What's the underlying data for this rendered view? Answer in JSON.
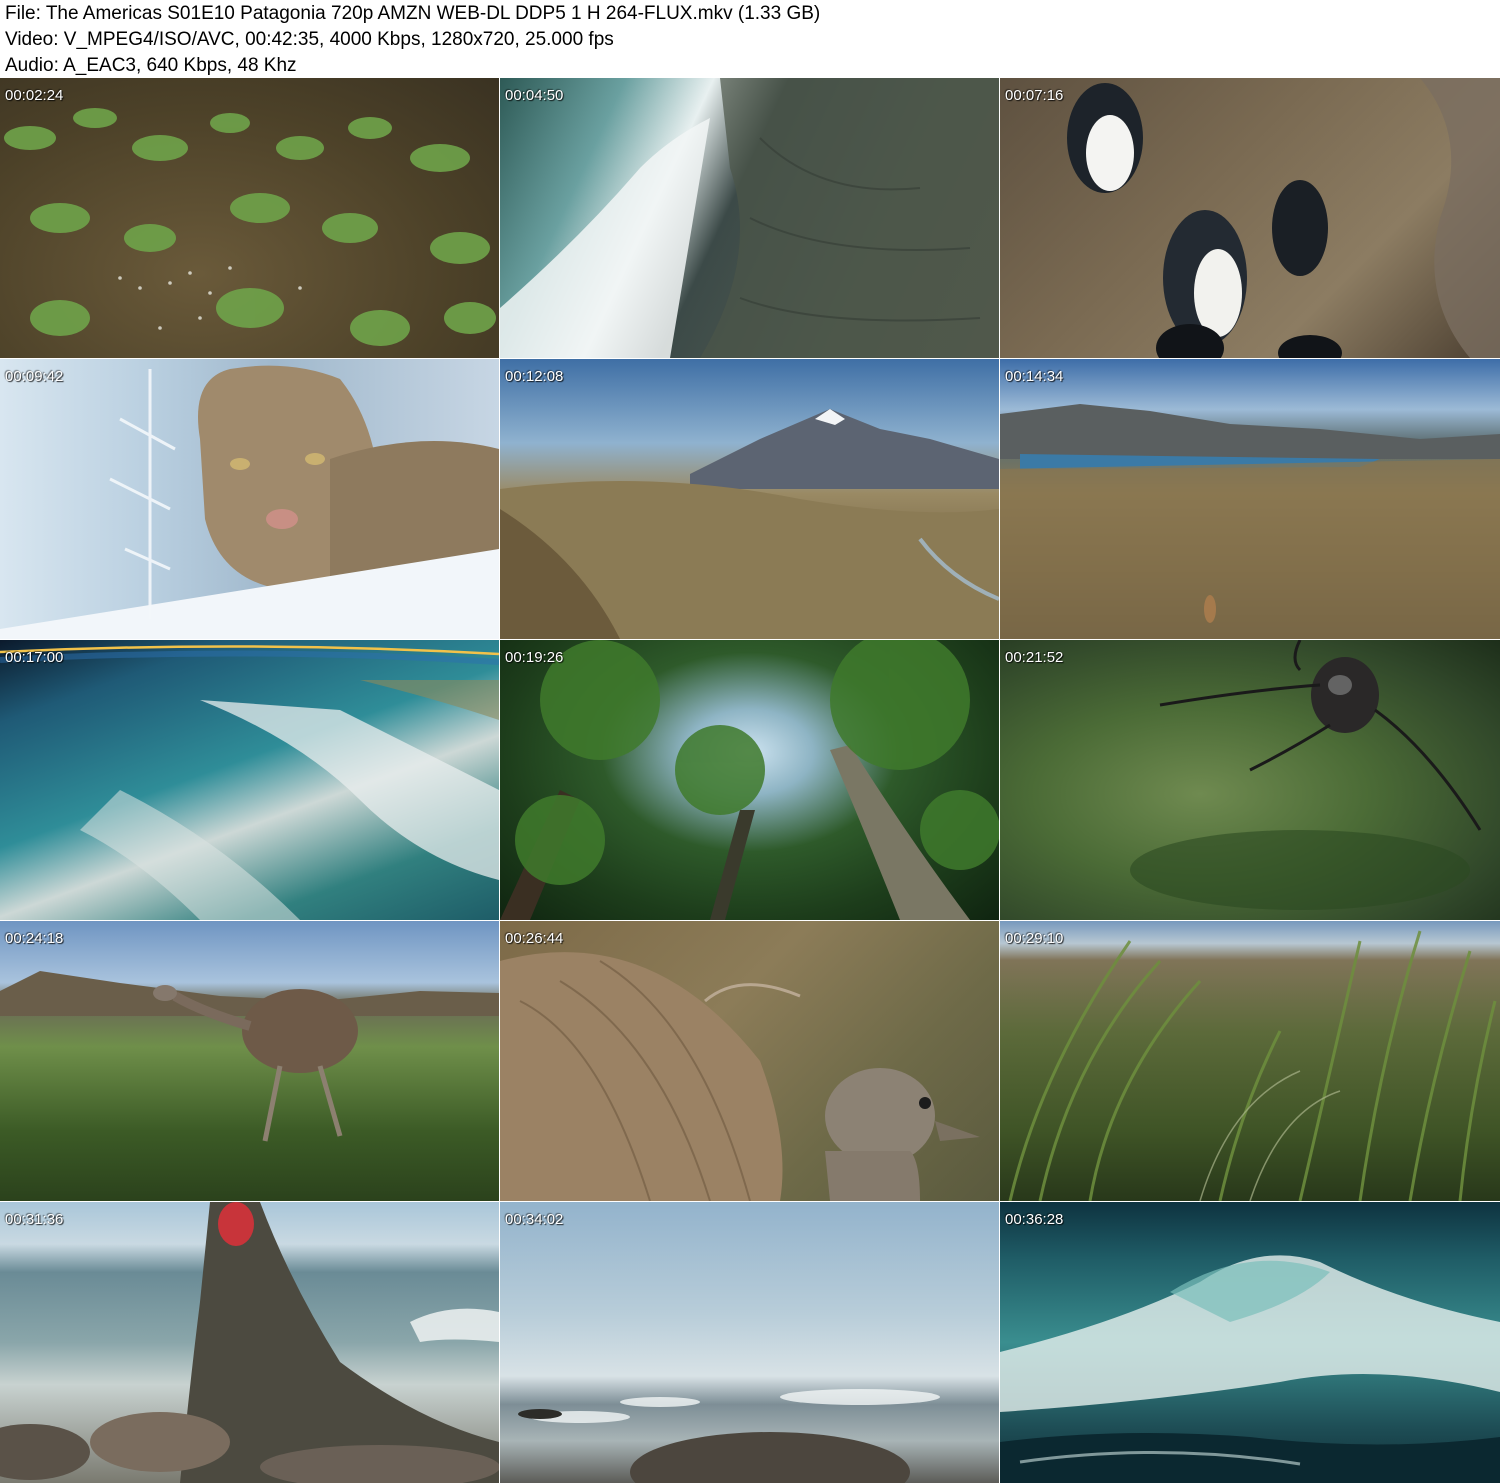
{
  "header": {
    "file_line": "File: The Americas S01E10 Patagonia 720p AMZN WEB-DL DDP5 1 H 264-FLUX.mkv (1.33 GB)",
    "video_line": "Video: V_MPEG4/ISO/AVC, 00:42:35, 4000 Kbps, 1280x720, 25.000 fps",
    "audio_line": "Audio: A_EAC3, 640 Kbps, 48 Khz"
  },
  "thumbnails": [
    {
      "timestamp": "00:02:24"
    },
    {
      "timestamp": "00:04:50"
    },
    {
      "timestamp": "00:07:16"
    },
    {
      "timestamp": "00:09:42"
    },
    {
      "timestamp": "00:12:08"
    },
    {
      "timestamp": "00:14:34"
    },
    {
      "timestamp": "00:17:00"
    },
    {
      "timestamp": "00:19:26"
    },
    {
      "timestamp": "00:21:52"
    },
    {
      "timestamp": "00:24:18"
    },
    {
      "timestamp": "00:26:44"
    },
    {
      "timestamp": "00:29:10"
    },
    {
      "timestamp": "00:31:36"
    },
    {
      "timestamp": "00:34:02"
    },
    {
      "timestamp": "00:36:28"
    }
  ]
}
